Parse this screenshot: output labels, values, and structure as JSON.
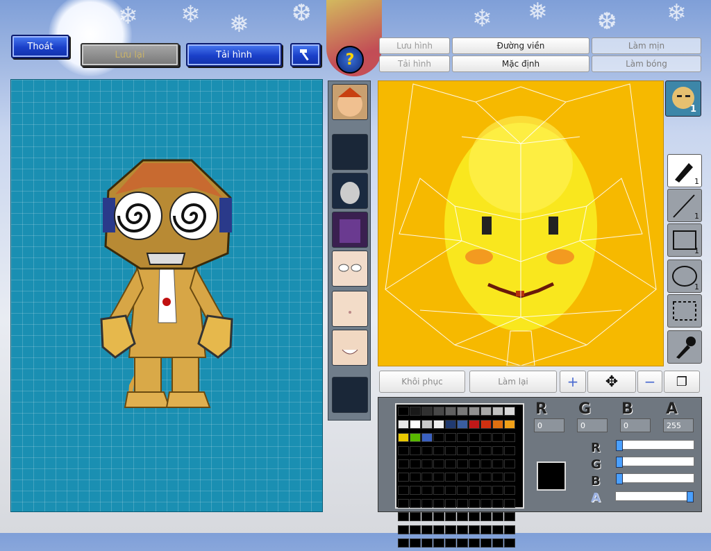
{
  "top_buttons": {
    "exit": "Thoát",
    "save": "Lưu lại",
    "reload": "Tải hình"
  },
  "help_icon": "question-icon",
  "hammer_icon": "hammer-icon",
  "editor_menu": {
    "save_image": "Lưu hình",
    "load_image": "Tải hình",
    "outline": "Đường viền",
    "default": "Mặc định",
    "smooth": "Làm mịn",
    "shadow": "Làm bóng"
  },
  "face_badge": "1",
  "tools": [
    {
      "name": "pen",
      "count": "1"
    },
    {
      "name": "line",
      "count": "1"
    },
    {
      "name": "rectangle",
      "count": "1"
    },
    {
      "name": "ellipse",
      "count": "1"
    },
    {
      "name": "selection",
      "count": ""
    },
    {
      "name": "eyedropper",
      "count": ""
    }
  ],
  "edit_actions": {
    "restore": "Khôi phục",
    "redo": "Làm lại"
  },
  "color": {
    "R": "0",
    "G": "0",
    "B": "0",
    "A": "255",
    "current_hex": "#000000"
  },
  "palette": [
    "#000000",
    "#181818",
    "#303030",
    "#484848",
    "#606060",
    "#787878",
    "#909090",
    "#a8a8a8",
    "#c0c0c0",
    "#d8d8d8",
    "#e8e8e8",
    "#ffffff",
    "#c8c8c8",
    "#f0f0f0",
    "#203a70",
    "#3a5ea0",
    "#c01818",
    "#d03010",
    "#e07010",
    "#f0a018",
    "#e8c800",
    "#58b800",
    "#3a60c0"
  ]
}
